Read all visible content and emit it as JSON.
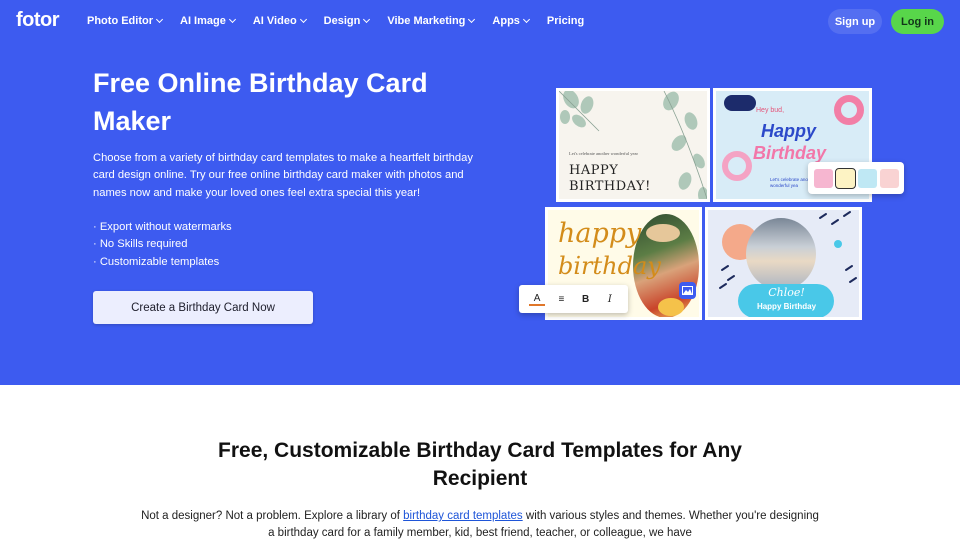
{
  "brand": {
    "logo": "fotor"
  },
  "nav": {
    "items": [
      {
        "label": "Photo Editor",
        "dropdown": true
      },
      {
        "label": "AI Image",
        "dropdown": true
      },
      {
        "label": "AI Video",
        "dropdown": true
      },
      {
        "label": "Design",
        "dropdown": true
      },
      {
        "label": "Vibe Marketing",
        "dropdown": true
      },
      {
        "label": "Apps",
        "dropdown": true
      },
      {
        "label": "Pricing",
        "dropdown": false
      }
    ],
    "signup": "Sign up",
    "login": "Log in"
  },
  "hero": {
    "title": "Free Online Birthday Card Maker",
    "description": "Choose from a variety of birthday card templates to make a heartfelt birthday card design online. Try our free online birthday card maker with photos and names now and make your loved ones feel extra special this year!",
    "bullets": [
      "· Export without watermarks",
      "· No Skills required",
      "· Customizable templates"
    ],
    "cta": "Create a Birthday Card Now"
  },
  "cards": {
    "card1": {
      "small": "Let's celebrate another wonderful year",
      "line1": "HAPPY",
      "line2": "BIRTHDAY!"
    },
    "card2": {
      "hey": "Hey bud,",
      "happy": "Happy",
      "birthday": "Birthday",
      "sub1": "Let's celebrate anot",
      "sub2": "wonderful yea"
    },
    "card3": {
      "happy": "happy",
      "birthday": "birthday"
    },
    "card4": {
      "name": "Chloe!",
      "tag": "Happy Birthday"
    }
  },
  "toolbar": {
    "color": "A",
    "align": "≡",
    "bold": "B",
    "italic": "I"
  },
  "swatch_colors": [
    "#f6b6d0",
    "#fdf3c4",
    "#bfe8f4",
    "#f9d3d3"
  ],
  "colors": {
    "hero_bg": "#3d5bf0",
    "login_bg": "#58d64a",
    "link": "#1e55d8"
  },
  "section2": {
    "title": "Free, Customizable Birthday Card Templates for Any Recipient",
    "p_before": "Not a designer? Not a problem. Explore a library of ",
    "p_link": "birthday card templates",
    "p_after": " with various styles and themes. Whether you're designing a birthday card for a family member, kid, best friend, teacher, or colleague, we have"
  }
}
